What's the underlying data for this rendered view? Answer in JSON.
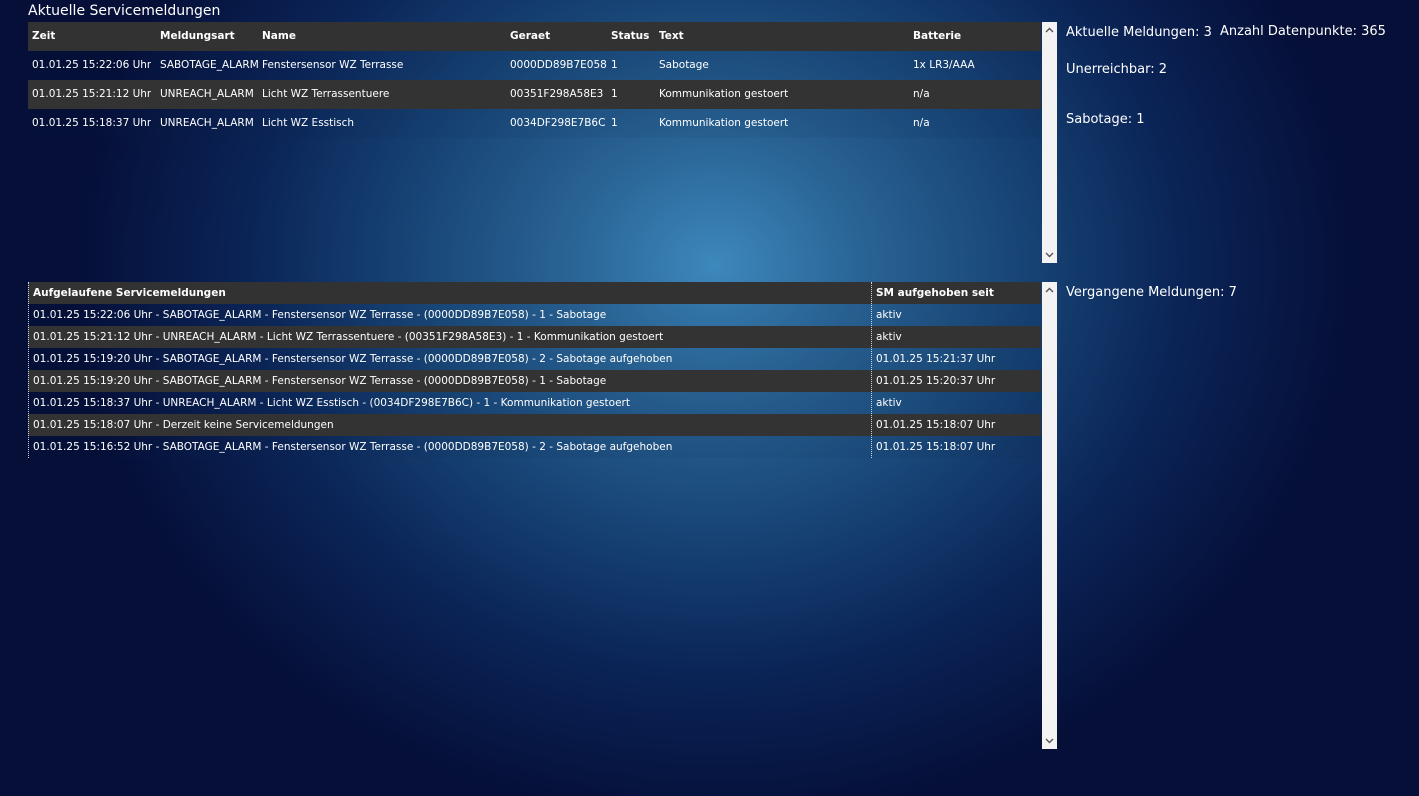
{
  "page": {
    "title": "Aktuelle Servicemeldungen"
  },
  "current": {
    "headers": {
      "time": "Zeit",
      "type": "Meldungsart",
      "name": "Name",
      "device": "Geraet",
      "status": "Status",
      "text": "Text",
      "battery": "Batterie"
    },
    "rows": [
      {
        "time": "01.01.25 15:22:06 Uhr",
        "type": "SABOTAGE_ALARM",
        "name": "Fenstersensor WZ Terrasse",
        "device": "0000DD89B7E058",
        "status": "1",
        "text": "Sabotage",
        "battery": "1x LR3/AAA"
      },
      {
        "time": "01.01.25 15:21:12 Uhr",
        "type": "UNREACH_ALARM",
        "name": "Licht WZ Terrassentuere",
        "device": "00351F298A58E3",
        "status": "1",
        "text": "Kommunikation gestoert",
        "battery": "n/a"
      },
      {
        "time": "01.01.25 15:18:37 Uhr",
        "type": "UNREACH_ALARM",
        "name": "Licht WZ Esstisch",
        "device": "0034DF298E7B6C",
        "status": "1",
        "text": "Kommunikation gestoert",
        "battery": "n/a"
      }
    ]
  },
  "stats": {
    "current_messages": "Aktuelle Meldungen: 3",
    "datapoints": "Anzahl Datenpunkte: 365",
    "unreachable": "Unerreichbar: 2",
    "sabotage": "Sabotage: 1",
    "past_messages": "Vergangene Meldungen: 7"
  },
  "history": {
    "headers": {
      "message": "Aufgelaufene Servicemeldungen",
      "resolved_since": "SM aufgehoben seit"
    },
    "rows": [
      {
        "message": "01.01.25 15:22:06 Uhr - SABOTAGE_ALARM - Fenstersensor WZ Terrasse - (0000DD89B7E058) - 1 - Sabotage",
        "since": "aktiv"
      },
      {
        "message": "01.01.25 15:21:12 Uhr - UNREACH_ALARM - Licht WZ Terrassentuere - (00351F298A58E3) - 1 - Kommunikation gestoert",
        "since": "aktiv"
      },
      {
        "message": "01.01.25 15:19:20 Uhr - SABOTAGE_ALARM - Fenstersensor WZ Terrasse - (0000DD89B7E058) - 2 - Sabotage aufgehoben",
        "since": "01.01.25 15:21:37 Uhr"
      },
      {
        "message": "01.01.25 15:19:20 Uhr - SABOTAGE_ALARM - Fenstersensor WZ Terrasse - (0000DD89B7E058) - 1 - Sabotage",
        "since": "01.01.25 15:20:37 Uhr"
      },
      {
        "message": "01.01.25 15:18:37 Uhr - UNREACH_ALARM - Licht WZ Esstisch - (0034DF298E7B6C) - 1 - Kommunikation gestoert",
        "since": "aktiv"
      },
      {
        "message": "01.01.25 15:18:07 Uhr - Derzeit keine Servicemeldungen",
        "since": "01.01.25 15:18:07 Uhr"
      },
      {
        "message": "01.01.25 15:16:52 Uhr - SABOTAGE_ALARM - Fenstersensor WZ Terrasse - (0000DD89B7E058) - 2 - Sabotage aufgehoben",
        "since": "01.01.25 15:18:07 Uhr"
      }
    ]
  },
  "icons": {
    "scroll_up": "chevron-up-icon",
    "scroll_down": "chevron-down-icon"
  }
}
